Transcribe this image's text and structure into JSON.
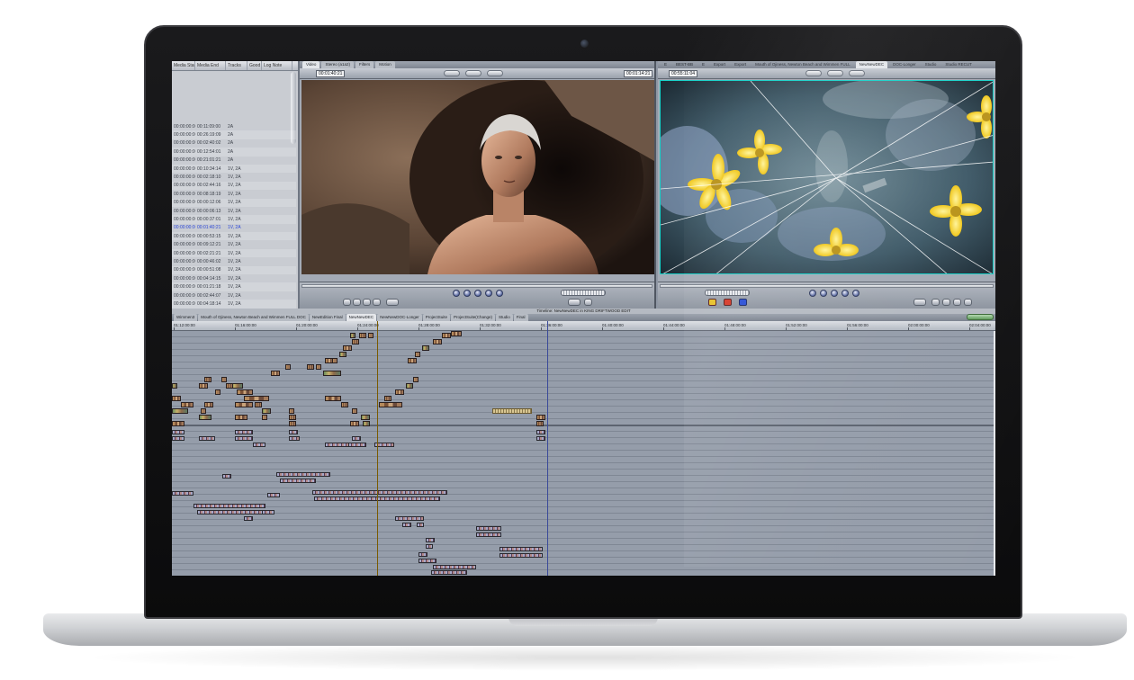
{
  "browser": {
    "columns": [
      "Media Start",
      "Media End",
      "Tracks",
      "Good",
      "Log Note"
    ],
    "rows": [
      {
        "start": "00:00:00:00",
        "end": "00:11:09:00",
        "tracks": "2A"
      },
      {
        "start": "00:00:00:00",
        "end": "00:26:19:09",
        "tracks": "2A"
      },
      {
        "start": "00:00:00:00",
        "end": "00:02:40:02",
        "tracks": "2A"
      },
      {
        "start": "00:00:00:00",
        "end": "00:12:54:01",
        "tracks": "2A"
      },
      {
        "start": "00:00:00:00",
        "end": "00:21:01:21",
        "tracks": "2A"
      },
      {
        "start": "00:00:00:00",
        "end": "00:10:34:14",
        "tracks": "1V, 2A"
      },
      {
        "start": "00:00:00:00",
        "end": "00:02:18:10",
        "tracks": "1V, 2A"
      },
      {
        "start": "00:00:00:00",
        "end": "00:02:44:16",
        "tracks": "1V, 2A"
      },
      {
        "start": "00:00:00:00",
        "end": "00:08:18:19",
        "tracks": "1V, 2A"
      },
      {
        "start": "00:00:00:00",
        "end": "00:00:12:06",
        "tracks": "1V, 2A"
      },
      {
        "start": "00:00:00:00",
        "end": "00:00:06:13",
        "tracks": "1V, 2A"
      },
      {
        "start": "00:00:00:00",
        "end": "00:00:37:01",
        "tracks": "1V, 2A"
      },
      {
        "start": "00:00:00:00",
        "end": "00:01:40:21",
        "tracks": "1V, 2A",
        "selected": true
      },
      {
        "start": "00:00:00:00",
        "end": "00:00:53:15",
        "tracks": "1V, 2A"
      },
      {
        "start": "00:00:00:00",
        "end": "00:09:12:21",
        "tracks": "1V, 2A"
      },
      {
        "start": "00:00:00:00",
        "end": "00:02:21:21",
        "tracks": "1V, 2A"
      },
      {
        "start": "00:00:00:00",
        "end": "00:00:46:02",
        "tracks": "1V, 2A"
      },
      {
        "start": "00:00:00:00",
        "end": "00:00:51:08",
        "tracks": "1V, 2A"
      },
      {
        "start": "00:00:00:00",
        "end": "00:04:14:15",
        "tracks": "1V, 2A"
      },
      {
        "start": "00:00:00:00",
        "end": "00:01:21:18",
        "tracks": "1V, 2A"
      },
      {
        "start": "00:00:00:00",
        "end": "00:02:44:07",
        "tracks": "1V, 2A"
      },
      {
        "start": "00:00:00:00",
        "end": "00:04:18:14",
        "tracks": "1V, 2A"
      },
      {
        "start": "00:00:00:00",
        "end": "00:00:00:00",
        "tracks": "1V, 2A"
      }
    ]
  },
  "viewer": {
    "tabs": [
      "Video",
      "Stereo (a1a2)",
      "Filters",
      "Motion"
    ],
    "timecode_left": "00:01:40:21",
    "timecode_right": "00:01:14:21",
    "zoom": "34%"
  },
  "canvas": {
    "tabs": [
      "E",
      "BEST-BB",
      "E",
      "Export",
      "Export",
      "Mouth of Ojiness, Newton Beach and Wimmen FULL",
      "NewNewDEC",
      "DOC-Longer",
      "Studio",
      "Studio RECUT"
    ],
    "timecode_left": "00:55:11:04",
    "zoom": "34%"
  },
  "timeline": {
    "title": "Timeline: NewNewDEC in KING DRIFTWOOD EDIT",
    "tabs": [
      "Wimmen3",
      "Mouth of Ojiness, Newton Beach and Wimmen FULL DOC",
      "NewEdition Final",
      "NewNewDEC",
      "NewNewDOC-Longer",
      "ProjectSuite",
      "ProjectSuite(Change)",
      "Studio",
      "Final"
    ],
    "ruler": [
      "01:12:00:00",
      "01:16:00:00",
      "01:20:00:00",
      "01:24:00:00",
      "01:28:00:00",
      "01:32:00:00",
      "01:36:00:00",
      "01:40:00:00",
      "01:44:00:00",
      "01:48:00:00",
      "01:52:00:00",
      "01:56:00:00",
      "02:00:00:00",
      "02:04:00:00"
    ]
  },
  "colors": {
    "bezel": "#0b0b0c",
    "ui_gray": "#a3aab5",
    "selected_text": "#2a46d8",
    "transport_blue": "#5a6aa3"
  }
}
